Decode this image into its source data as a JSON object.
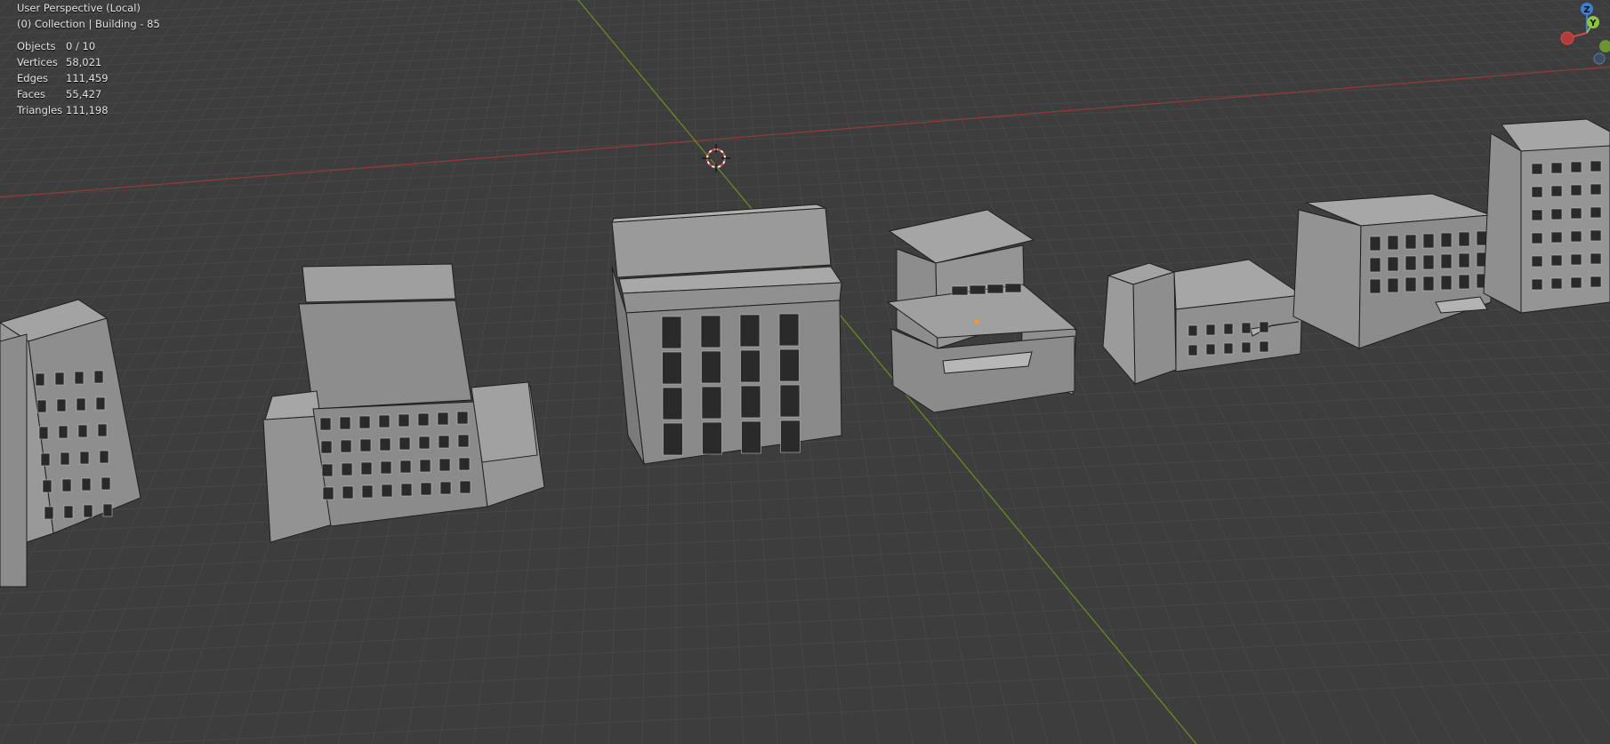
{
  "viewport": {
    "view_name": "User Perspective (Local)",
    "collection_info": "(0) Collection | Building - 85"
  },
  "stats": [
    {
      "label": "Objects",
      "value": "0 / 10"
    },
    {
      "label": "Vertices",
      "value": "58,021"
    },
    {
      "label": "Edges",
      "value": "111,459"
    },
    {
      "label": "Faces",
      "value": "55,427"
    },
    {
      "label": "Triangles",
      "value": "111,198"
    }
  ],
  "gizmo": {
    "z_label": "Z",
    "y_label": "Y"
  },
  "colors": {
    "background": "#3d3d3d",
    "grid": "#4a4a4a",
    "x_axis": "#9a3a3a",
    "y_axis": "#6f8f1f",
    "mesh_face": "#9b9b9b",
    "mesh_edge": "#1f1f1f",
    "axis_z": "#3a7fd8",
    "axis_y": "#8cc63f",
    "axis_x": "#d94b4b"
  },
  "icons": [
    "3d-cursor-icon",
    "navigation-gizmo-icon"
  ]
}
